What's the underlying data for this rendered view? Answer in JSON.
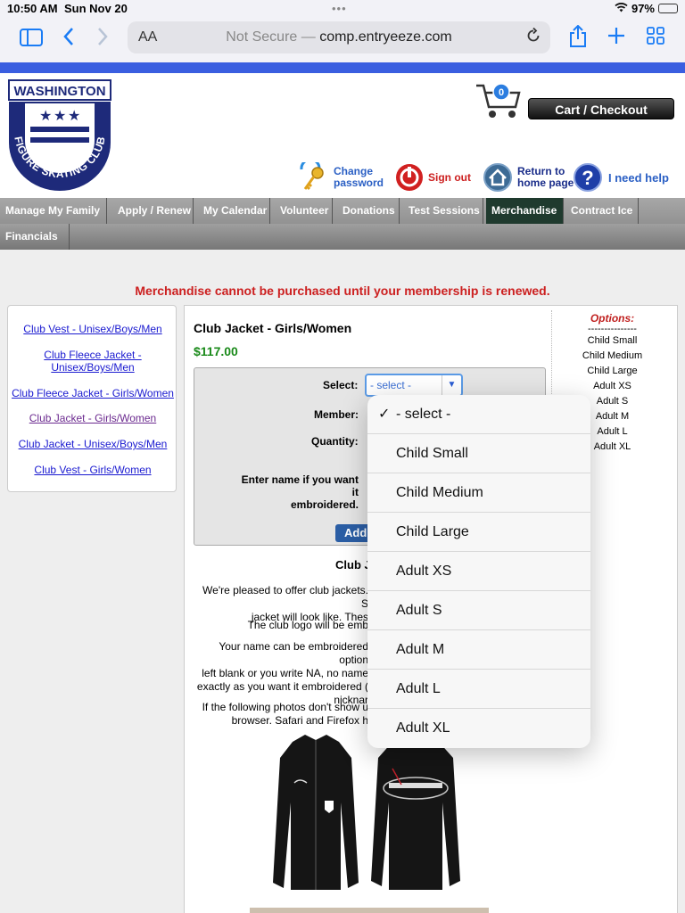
{
  "status": {
    "time": "10:50 AM",
    "date": "Sun Nov 20",
    "battery": "97%"
  },
  "browser": {
    "text_size": "AA",
    "security": "Not Secure —",
    "domain": "comp.entryeeze.com"
  },
  "logo": {
    "text_top": "WASHINGTON",
    "text_arc": "FIGURE SKATING CLUB"
  },
  "cart": {
    "count": "0",
    "checkout_label": "Cart / Checkout"
  },
  "header_links": {
    "change_password_1": "Change",
    "change_password_2": "password",
    "sign_out": "Sign out",
    "home_1": "Return to",
    "home_2": "home page",
    "help": "I need help"
  },
  "nav": {
    "items": [
      "Manage My Family",
      "Apply / Renew",
      "My Calendar",
      "Volunteer",
      "Donations",
      "Test Sessions",
      "Merchandise",
      "Contract Ice"
    ],
    "row2": [
      "Financials"
    ],
    "active": "Merchandise"
  },
  "warning": "Merchandise cannot be purchased until your membership is renewed.",
  "sidebar": {
    "links": [
      "Club Vest - Unisex/Boys/Men",
      "Club Fleece Jacket - Unisex/Boys/Men",
      "Club Fleece Jacket - Girls/Women",
      "Club Jacket - Girls/Women",
      "Club Jacket - Unisex/Boys/Men",
      "Club Vest - Girls/Women"
    ]
  },
  "product": {
    "title": "Club Jacket - Girls/Women",
    "price": "$117.00",
    "labels": {
      "select": "Select:",
      "member": "Member:",
      "quantity": "Quantity:",
      "embroider_1": "Enter name if you want it",
      "embroider_2": "embroidered."
    },
    "select_value": "- select -",
    "add_button": "Add",
    "desc_title": "Club J",
    "desc_lines": [
      "We're pleased to offer club jackets. S",
      "jacket will look like. Thes",
      "The club logo will be emb",
      "Your name can be embroidered option",
      "left blank or you write NA, no name",
      "exactly as you want it embroidered (",
      "nicknar",
      "If the following photos don't show u",
      "browser. Safari and Firefox h"
    ]
  },
  "options": {
    "heading": "Options:",
    "separator": "---------------",
    "list": [
      "Child Small",
      "Child Medium",
      "Child Large",
      "Adult XS",
      "Adult S",
      "Adult M",
      "Adult L",
      "Adult XL"
    ]
  },
  "dropdown": {
    "checkmark": "✓",
    "items": [
      "- select -",
      "Child Small",
      "Child Medium",
      "Child Large",
      "Adult XS",
      "Adult S",
      "Adult M",
      "Adult L",
      "Adult XL"
    ],
    "selected_index": 0
  }
}
